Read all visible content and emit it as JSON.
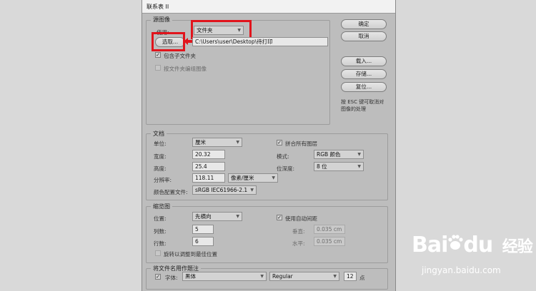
{
  "window": {
    "title": "联系表 II"
  },
  "source": {
    "legend": "源图像",
    "use_label": "使用:",
    "use_value": "文件夹",
    "choose_button": "选取...",
    "path": "C:\\Users\\user\\Desktop\\待打印",
    "include_subfolders": "包含子文件夹",
    "group_by_folder": "按文件夹编组图像"
  },
  "side": {
    "ok": "确定",
    "cancel": "取消",
    "load": "载入...",
    "save": "存储...",
    "reset": "复位...",
    "esc_note_1": "按 ESC 键可取消对",
    "esc_note_2": "图像的处理"
  },
  "document": {
    "legend": "文档",
    "units_label": "单位:",
    "units_value": "厘米",
    "width_label": "宽度:",
    "width_value": "20.32",
    "height_label": "高度:",
    "height_value": "25.4",
    "resolution_label": "分辨率:",
    "resolution_value": "118.11",
    "resolution_unit": "像素/厘米",
    "profile_label": "颜色配置文件:",
    "profile_value": "sRGB IEC61966-2.1",
    "flatten_label": "拼合所有图层",
    "mode_label": "模式:",
    "mode_value": "RGB 颜色",
    "depth_label": "位深度:",
    "depth_value": "8 位"
  },
  "thumbnails": {
    "legend": "缩览图",
    "place_label": "位置:",
    "place_value": "先横向",
    "columns_label": "列数:",
    "columns_value": "5",
    "rows_label": "行数:",
    "rows_value": "6",
    "rotate_label": "旋转以调整到最佳位置",
    "auto_spacing_label": "使用自动间距",
    "vertical_label": "垂直:",
    "vertical_value": "0.035 cm",
    "horizontal_label": "水平:",
    "horizontal_value": "0.035 cm"
  },
  "caption": {
    "legend": "将文件名用作题注",
    "font_label": "字体:",
    "font_value": "黑体",
    "style_value": "Regular",
    "size_value": "12",
    "size_unit": "点"
  },
  "watermark": {
    "brand_a": "Bai",
    "brand_b": "du",
    "brand_cn": "经验",
    "url": "jingyan.baidu.com"
  },
  "colors": {
    "highlight": "#e1141c",
    "dialog_bg": "#bdbdbd",
    "page_bg": "#d9d9d9"
  }
}
